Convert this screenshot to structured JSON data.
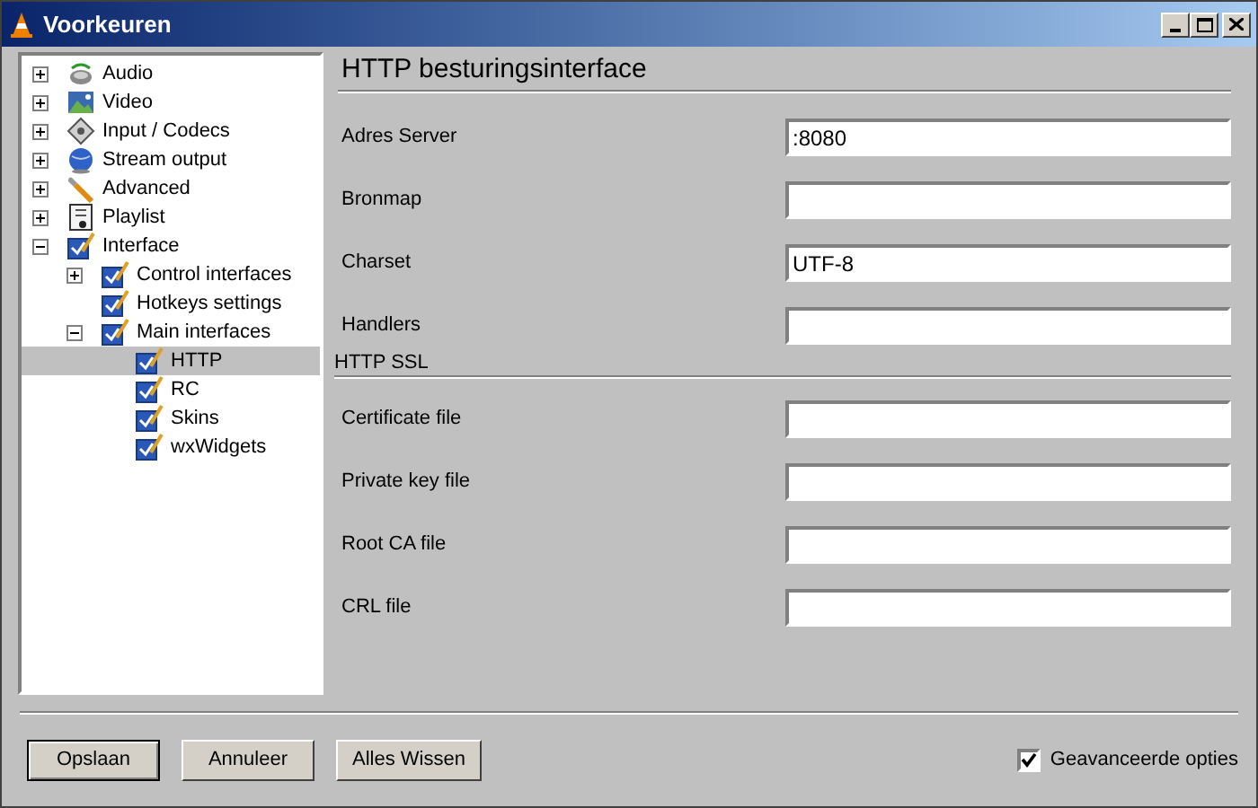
{
  "window": {
    "title": "Voorkeuren"
  },
  "tree": [
    {
      "label": "Audio",
      "expanded": false,
      "selected": false
    },
    {
      "label": "Video",
      "expanded": false,
      "selected": false
    },
    {
      "label": "Input / Codecs",
      "expanded": false,
      "selected": false
    },
    {
      "label": "Stream output",
      "expanded": false,
      "selected": false
    },
    {
      "label": "Advanced",
      "expanded": false,
      "selected": false
    },
    {
      "label": "Playlist",
      "expanded": false,
      "selected": false
    },
    {
      "label": "Interface",
      "expanded": true,
      "selected": false,
      "children": [
        {
          "label": "Control interfaces",
          "expanded": false,
          "selected": false
        },
        {
          "label": "Hotkeys settings",
          "selected": false
        },
        {
          "label": "Main interfaces",
          "expanded": true,
          "selected": false,
          "children": [
            {
              "label": "HTTP",
              "selected": true
            },
            {
              "label": "RC",
              "selected": false
            },
            {
              "label": "Skins",
              "selected": false
            },
            {
              "label": "wxWidgets",
              "selected": false
            }
          ]
        }
      ]
    }
  ],
  "panel": {
    "title": "HTTP besturingsinterface",
    "fields": [
      {
        "kind": "field",
        "label": "Adres Server",
        "value": ":8080"
      },
      {
        "kind": "field",
        "label": "Bronmap"
      },
      {
        "kind": "field",
        "label": "Charset",
        "value": "UTF-8"
      },
      {
        "kind": "field",
        "label": "Handlers"
      },
      {
        "kind": "section",
        "label": "HTTP SSL"
      },
      {
        "kind": "field",
        "label": "Certificate file"
      },
      {
        "kind": "field",
        "label": "Private key file"
      },
      {
        "kind": "field",
        "label": "Root CA file"
      },
      {
        "kind": "field",
        "label": "CRL file"
      }
    ]
  },
  "buttons": [
    {
      "label": "Opslaan",
      "default": true
    },
    {
      "label": "Annuleer",
      "default": false
    },
    {
      "label": "Alles Wissen",
      "default": false
    }
  ],
  "advanced_options": {
    "label": "Geavanceerde opties",
    "checked": true
  }
}
